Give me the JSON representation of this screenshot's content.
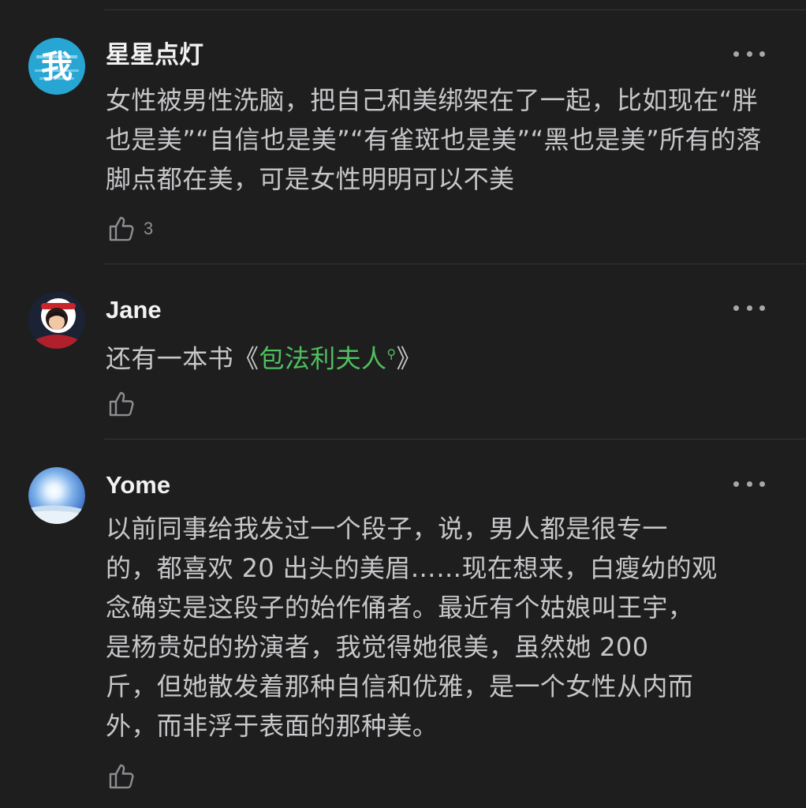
{
  "comments": [
    {
      "username": "星星点灯",
      "avatar_glyph": "我",
      "text": "女性被男性洗脑，把自己和美绑架在了一起，比如现在“胖也是美”“自信也是美”“有雀斑也是美”“黑也是美”所有的落脚点都在美，可是女性明明可以不美",
      "like_count": "3"
    },
    {
      "username": "Jane",
      "text_prefix": "还有一本书《",
      "link_text": "包法利夫人",
      "text_suffix": "》",
      "like_count": ""
    },
    {
      "username": "Yome",
      "text_lines": [
        "以前同事给我发过一个段子，说，男人都是很专一",
        "的，都喜欢 20 出头的美眉……现在想来，白瘦幼的观",
        "念确实是这段子的始作俑者。最近有个姑娘叫王宇，",
        "是杨贵妃的扮演者，我觉得她很美，虽然她 200",
        "斤，但她散发着那种自信和优雅，是一个女性从内而",
        "外，而非浮于表面的那种美。"
      ],
      "like_count": ""
    }
  ],
  "icons": {
    "more": "more-dots-icon",
    "like": "thumbs-up-icon",
    "search": "search-icon"
  },
  "colors": {
    "background": "#1e1e1f",
    "link": "#4fbf5f",
    "text": "#c7c7c9"
  }
}
